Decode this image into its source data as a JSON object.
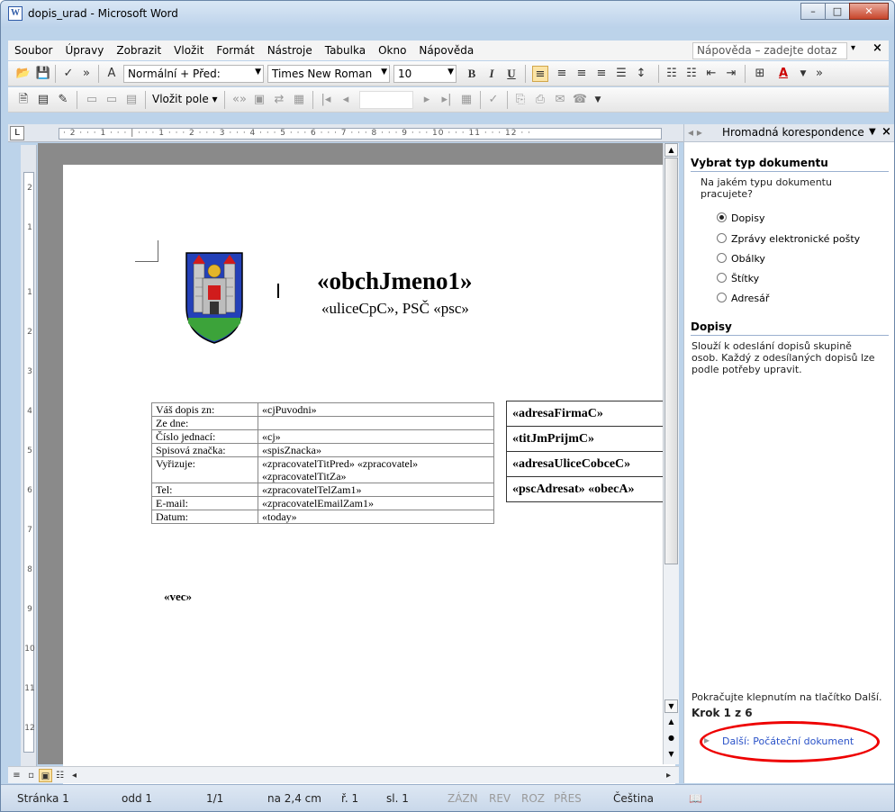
{
  "window": {
    "title": "dopis_urad - Microsoft Word",
    "minimize": "–",
    "maximize": "□",
    "close": "✕"
  },
  "menu": {
    "items": [
      "Soubor",
      "Úpravy",
      "Zobrazit",
      "Vložit",
      "Formát",
      "Nástroje",
      "Tabulka",
      "Okno",
      "Nápověda"
    ],
    "help_placeholder": "Nápověda – zadejte dotaz",
    "help_arrow": "▾",
    "close_doc": "×"
  },
  "toolbar": {
    "style_value": "Normální + Před:",
    "font_value": "Times New Roman",
    "size_value": "10",
    "bold": "B",
    "italic": "I",
    "underline": "U",
    "insert_field": "Vložit pole ▾"
  },
  "ruler": {
    "horizontal": "· 2 · · · 1 · · · | · · · 1 · · · 2 · · · 3 · · · 4 · · · 5 · · · 6 · · · 7 · · · 8 · · · 9 · · · 10 · · · 11 · · · 12 · ·",
    "vertical_marks": [
      "2",
      "1",
      "1",
      "2",
      "3",
      "4",
      "5",
      "6",
      "7",
      "8",
      "9",
      "10",
      "11",
      "12"
    ],
    "tab_glyph": "L"
  },
  "document": {
    "firm_name": "«obchJmeno1»",
    "firm_address": "«uliceCpC», PSČ «psc»",
    "info_rows": [
      {
        "label": "Váš dopis zn:",
        "value": "«cjPuvodni»"
      },
      {
        "label": "Ze dne:",
        "value": ""
      },
      {
        "label": "Číslo jednací:",
        "value": "«cj»"
      },
      {
        "label": "Spisová značka:",
        "value": "«spisZnacka»"
      },
      {
        "label": "Vyřizuje:",
        "value": "«zpracovatelTitPred» «zpracovatel» «zpracovatelTitZa»"
      },
      {
        "label": "Tel:",
        "value": "«zpracovatelTelZam1»"
      },
      {
        "label": "E-mail:",
        "value": "«zpracovatelEmailZam1»"
      },
      {
        "label": "Datum:",
        "value": "«today»"
      }
    ],
    "address_rows": [
      "«adresaFirmaC»",
      "«titJmPrijmC»",
      "«adresaUliceCobceC»",
      "«pscAdresat» «obecA»"
    ],
    "subject": "«vec»"
  },
  "taskpane": {
    "title": "Hromadná korespondence",
    "section1": "Vybrat typ dokumentu",
    "question": "Na jakém typu dokumentu pracujete?",
    "options": [
      "Dopisy",
      "Zprávy elektronické pošty",
      "Obálky",
      "Štítky",
      "Adresář"
    ],
    "selected": "Dopisy",
    "section2": "Dopisy",
    "description": "Slouží k odeslání dopisů skupině osob. Každý z odesílaných dopisů lze podle potřeby upravit.",
    "continue_hint": "Pokračujte klepnutím na tlačítko Další.",
    "step": "Krok 1 z 6",
    "next_link": "Další: Počáteční dokument"
  },
  "status": {
    "page": "Stránka 1",
    "section": "odd 1",
    "pages": "1/1",
    "position": "na 2,4 cm",
    "line": "ř. 1",
    "column": "sl. 1",
    "rec": "ZÁZN",
    "trk": "REV",
    "ext": "ROZ",
    "ovr": "PŘES",
    "language": "Čeština"
  }
}
